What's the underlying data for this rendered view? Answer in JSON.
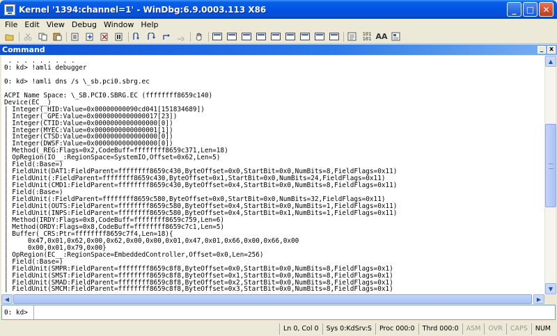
{
  "window": {
    "title": "Kernel '1394:channel=1' - WinDbg:6.9.0003.113 X86",
    "minimize_glyph": "_",
    "maximize_glyph": "□",
    "close_glyph": "✕"
  },
  "menu": [
    "File",
    "Edit",
    "View",
    "Debug",
    "Window",
    "Help"
  ],
  "toolbar": {
    "icons": [
      "open-icon",
      "cut-icon",
      "copy-icon",
      "paste-icon",
      "go-icon",
      "restart-icon",
      "stop-debugging-icon",
      "break-icon",
      "step-into-icon",
      "step-over-icon",
      "step-out-icon",
      "run-to-cursor-icon",
      "hand-icon",
      "command-window-icon",
      "watch-window-icon",
      "locals-window-icon",
      "registers-window-icon",
      "memory-window-icon",
      "call-stack-icon",
      "disassembly-window-icon",
      "scratch-pad-icon",
      "processes-threads-icon",
      "source-mode-icon",
      "font-icon",
      "options-icon"
    ],
    "source_mode_label": "101\n101",
    "font_label": "AA"
  },
  "pane": {
    "title": "Command",
    "minimize_glyph": "_",
    "close_glyph": "x"
  },
  "output": {
    "text": " . . . . . . . . .\n0: kd> !amli debugger\n\n0: kd> !amli dns /s \\_sb.pci0.sbrg.ec\n\nACPI Name Space: \\_SB.PCI0.SBRG.EC (ffffffff8659c140)\nDevice(EC__)\n| Integer(_HID:Value=0x00000000090cd041[151834689])\n| Integer(_GPE:Value=0x0000000000000017[23])\n| Integer(CTID:Value=0x0000000000000000[0])\n| Integer(MYEC:Value=0x0000000000000001[1])\n| Integer(CTSD:Value=0x0000000000000000[0])\n| Integer(DWSF:Value=0x0000000000000000[0])\n| Method(_REG:Flags=0x2,CodeBuff=ffffffff8659c371,Len=18)\n| OpRegion(IO__:RegionSpace=SystemIO,Offset=0x62,Len=5)\n| Field(:Base=)\n| FieldUnit(DAT1:FieldParent=ffffffff8659c430,ByteOffset=0x0,StartBit=0x0,NumBits=8,FieldFlags=0x11)\n| FieldUnit(:FieldParent=ffffffff8659c430,ByteOffset=0x1,StartBit=0x0,NumBits=24,FieldFlags=0x11)\n| FieldUnit(CMD1:FieldParent=ffffffff8659c430,ByteOffset=0x4,StartBit=0x0,NumBits=8,FieldFlags=0x11)\n| Field(:Base=)\n| FieldUnit(:FieldParent=ffffffff8659c580,ByteOffset=0x0,StartBit=0x0,NumBits=32,FieldFlags=0x11)\n| FieldUnit(OUTS:FieldParent=ffffffff8659c580,ByteOffset=0x4,StartBit=0x0,NumBits=1,FieldFlags=0x11)\n| FieldUnit(INPS:FieldParent=ffffffff8659c580,ByteOffset=0x4,StartBit=0x1,NumBits=1,FieldFlags=0x11)\n| Method(IRDY:Flags=0x8,CodeBuff=ffffffff8659c759,Len=6)\n| Method(ORDY:Flags=0x8,CodeBuff=ffffffff8659c7c1,Len=5)\n| Buffer(_CRS:Ptr=ffffffff8659c7f4,Len=18){\n|     0x47,0x01,0x62,0x00,0x62,0x00,0x00,0x01,0x47,0x01,0x66,0x00,0x66,0x00\n|     0x00,0x01,0x79,0x00}\n| OpRegion(EC__:RegionSpace=EmbeddedController,Offset=0x0,Len=256)\n| Field(:Base=)\n| FieldUnit(SMPR:FieldParent=ffffffff8659c8f8,ByteOffset=0x0,StartBit=0x0,NumBits=8,FieldFlags=0x1)\n| FieldUnit(SMST:FieldParent=ffffffff8659c8f8,ByteOffset=0x1,StartBit=0x0,NumBits=8,FieldFlags=0x1)\n| FieldUnit(SMAD:FieldParent=ffffffff8659c8f8,ByteOffset=0x2,StartBit=0x0,NumBits=8,FieldFlags=0x1)\n| FieldUnit(SMCM:FieldParent=ffffffff8659c8f8,ByteOffset=0x3,StartBit=0x0,NumBits=8,FieldFlags=0x1)"
  },
  "command_input": {
    "prompt": "0: kd>",
    "value": ""
  },
  "status": {
    "ln_col": "Ln 0, Col 0",
    "sys": "Sys 0:KdSrv:S",
    "proc": "Proc 000:0",
    "thrd": "Thrd 000:0",
    "asm": "ASM",
    "ovr": "OVR",
    "caps": "CAPS",
    "num": "NUM"
  },
  "colors": {
    "titlebar": "#0054e3",
    "pane_title": "#2c7ae8",
    "chrome": "#ece9d8"
  }
}
